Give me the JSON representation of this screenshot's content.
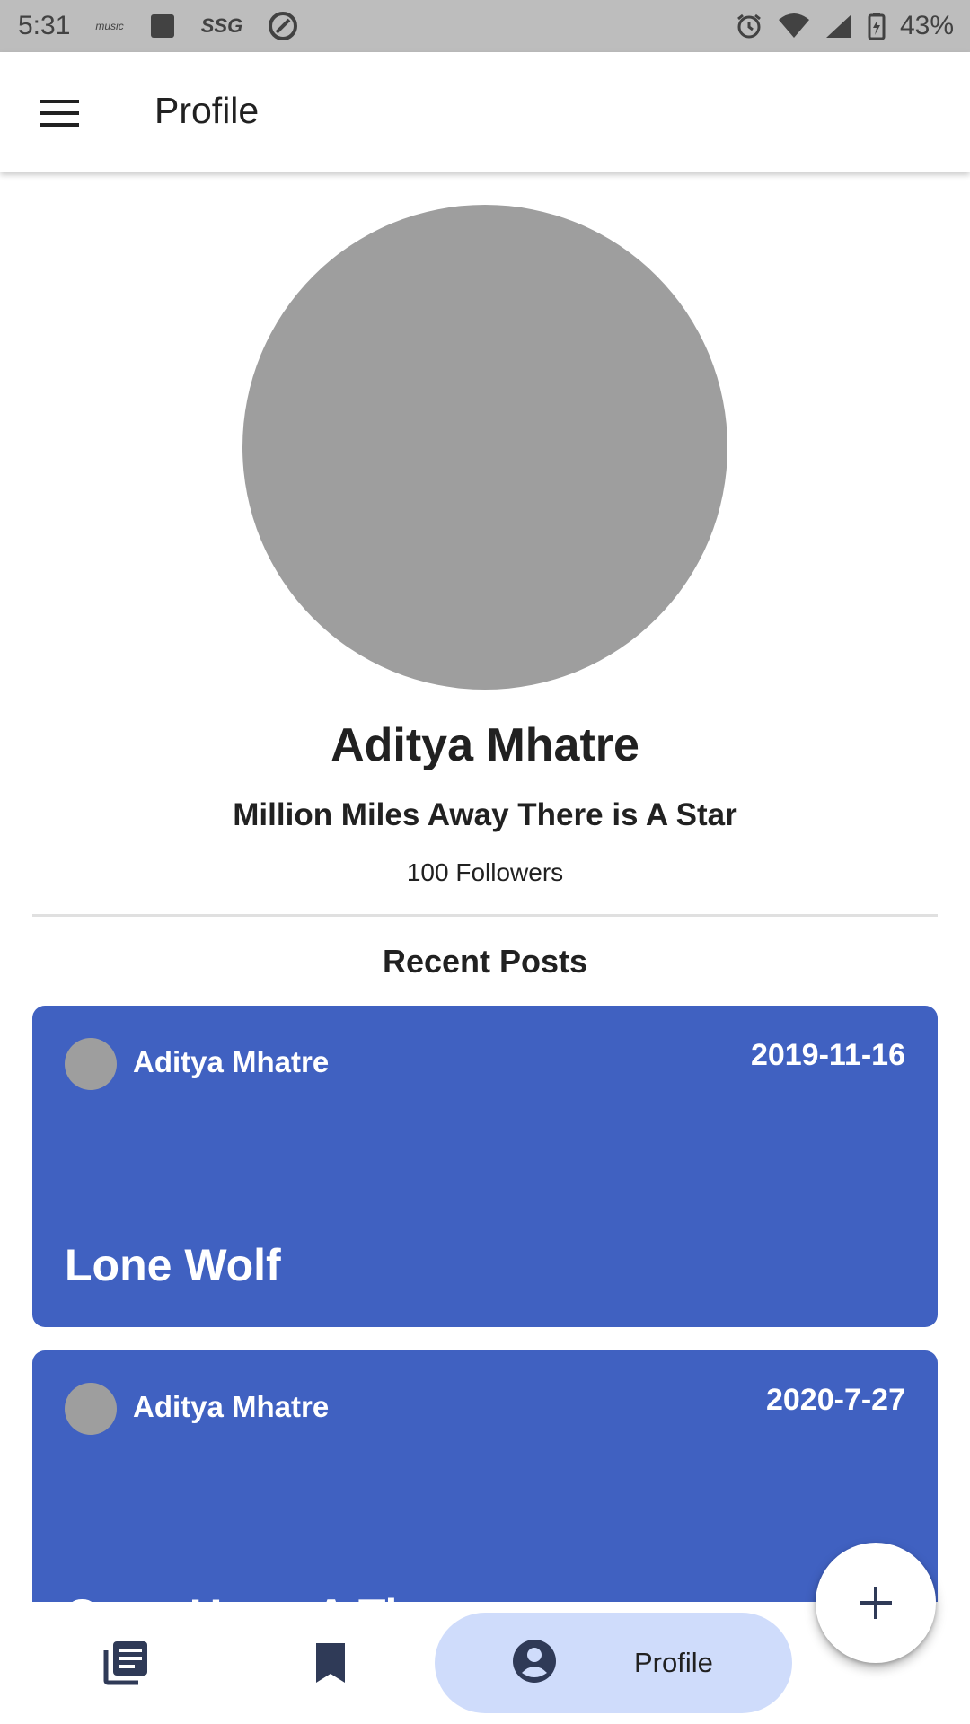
{
  "status_bar": {
    "time": "5:31",
    "music_label": "music",
    "ssg_label": "SSG",
    "battery_percent": "43%",
    "icons": [
      "amazon-music-icon",
      "square-app-icon",
      "ssg-icon",
      "circle-app-icon",
      "alarm-icon",
      "wifi-icon",
      "signal-icon",
      "battery-charging-icon"
    ]
  },
  "app_bar": {
    "title": "Profile",
    "menu_icon": "menu-icon"
  },
  "profile": {
    "name": "Aditya Mhatre",
    "tagline": "Million Miles Away There is A Star",
    "followers": "100 Followers"
  },
  "recent_posts": {
    "heading": "Recent Posts",
    "posts": [
      {
        "author": "Aditya Mhatre",
        "date": "2019-11-16",
        "title": "Lone Wolf"
      },
      {
        "author": "Aditya Mhatre",
        "date": "2020-7-27",
        "title": "Once Upon A Time"
      }
    ]
  },
  "bottom_nav": {
    "items": [
      {
        "icon": "article-list-icon",
        "label": ""
      },
      {
        "icon": "bookmark-icon",
        "label": ""
      },
      {
        "icon": "account-circle-icon",
        "label": "Profile"
      }
    ],
    "selected": "Profile"
  },
  "fab": {
    "icon": "plus-icon"
  },
  "colors": {
    "card_background": "#4061c1",
    "nav_selected_background": "#cfdcfb",
    "status_bar": "#bdbdbd",
    "avatar_placeholder": "#9e9e9e"
  }
}
